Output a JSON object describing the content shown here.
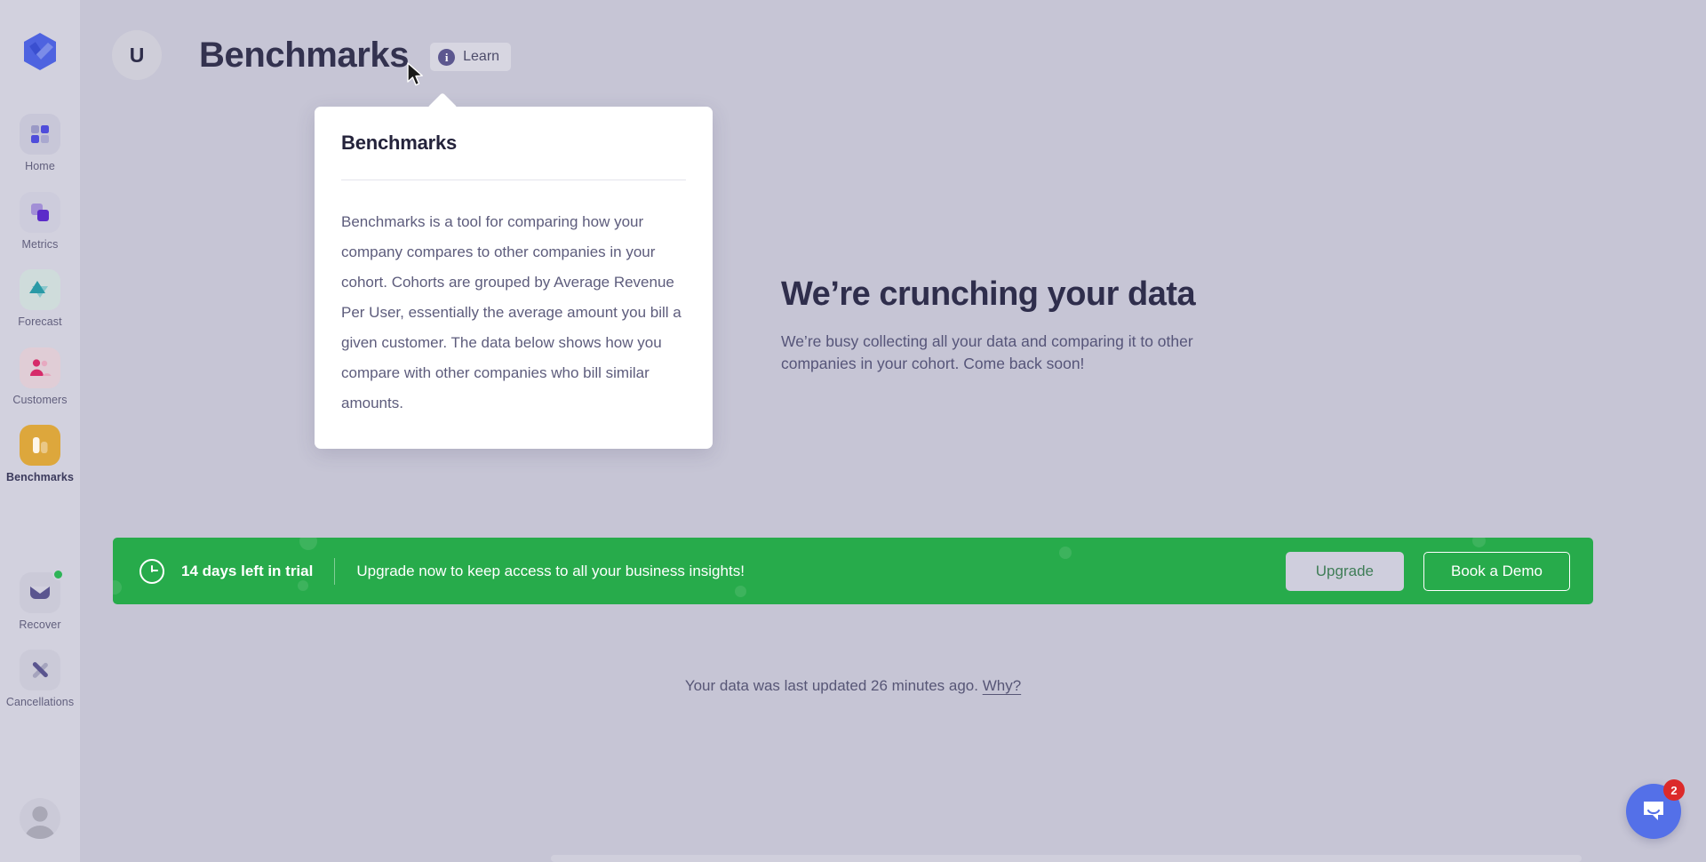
{
  "app": {
    "background_color": "#c6c5d5",
    "sidebar_color": "#d2d1de",
    "accent_color": "#5470e8",
    "brand_logo_name": "baremetrics-logo"
  },
  "sidebar": {
    "items": [
      {
        "label": "Home",
        "icon": "grid-squares-icon",
        "tile_color": "#c8c7d8",
        "active": false
      },
      {
        "label": "Metrics",
        "icon": "layers-icon",
        "tile_color": "#cdccdc",
        "active": false
      },
      {
        "label": "Forecast",
        "icon": "triangles-icon",
        "tile_color": "#cfdcdb",
        "active": false
      },
      {
        "label": "Customers",
        "icon": "people-icon",
        "tile_color": "#e0cdd6",
        "active": false
      },
      {
        "label": "Benchmarks",
        "icon": "bar-chart-icon",
        "tile_color": "#dda73c",
        "active": true
      },
      {
        "label": "Recover",
        "icon": "envelope-icon",
        "tile_color": "#cbcad8",
        "active": false,
        "badge": true
      },
      {
        "label": "Cancellations",
        "icon": "x-cross-icon",
        "tile_color": "#cbcad8",
        "active": false
      }
    ],
    "avatar_name": "user-avatar"
  },
  "header": {
    "org_initial": "U",
    "title": "Benchmarks",
    "learn_label": "Learn",
    "learn_icon": "info-icon"
  },
  "popover": {
    "title": "Benchmarks",
    "body": "Benchmarks is a tool for comparing how your company compares to other companies in your cohort. Cohorts are grouped by Average Revenue Per User, essentially the average amount you bill a given customer. The data below shows how you compare with other companies who bill similar amounts."
  },
  "main": {
    "empty_title": "We’re crunching your data",
    "empty_subtitle": "We’re busy collecting all your data and comparing it to other companies in your cohort. Come back soon!"
  },
  "trial_banner": {
    "background_color": "#27ab4b",
    "clock_icon": "clock-icon",
    "days_left": "14 days left in trial",
    "message": "Upgrade now to keep access to all your business insights!",
    "upgrade_label": "Upgrade",
    "demo_label": "Book a Demo"
  },
  "footer": {
    "updated_text": "Your data was last updated 26 minutes ago.",
    "why_label": "Why?"
  },
  "chat": {
    "icon": "chat-bubble-icon",
    "unread_count": "2",
    "badge_color": "#dc2a2a",
    "button_color": "#5470e8"
  }
}
